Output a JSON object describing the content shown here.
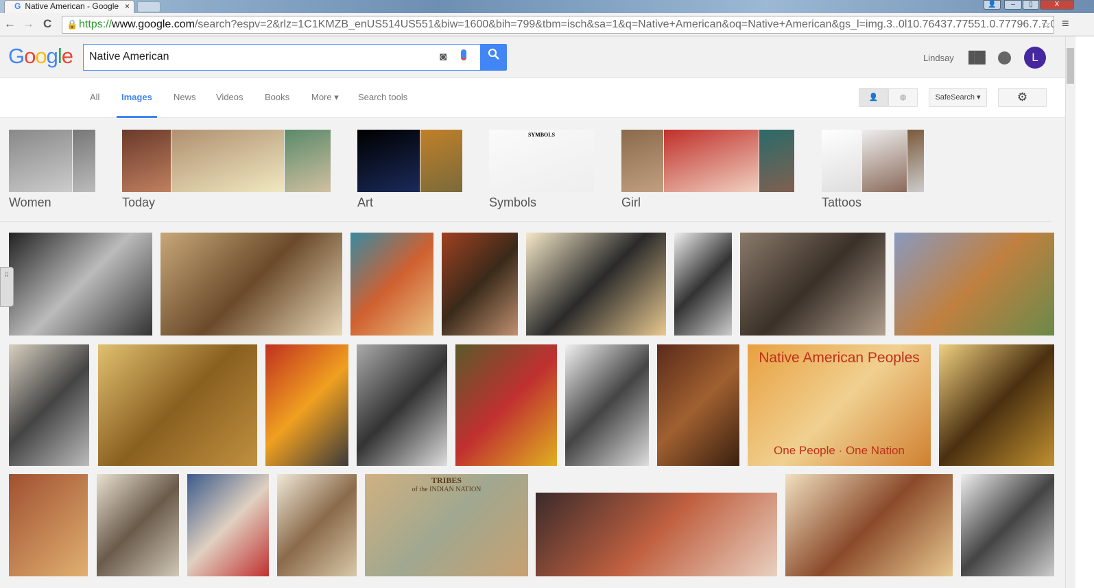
{
  "browser": {
    "tab_title": "Native American - Google",
    "tab_close": "×",
    "url_scheme": "https://",
    "url_host": "www.google.com",
    "url_rest": "/search?espv=2&rlz=1C1KMZB_enUS514US551&biw=1600&bih=799&tbm=isch&sa=1&q=Native+American&oq=Native+American&gs_l=img.3..0l10.76437.77551.0.77796.7.7.0",
    "back": "←",
    "forward": "→",
    "reload": "C",
    "star": "☆",
    "menu": "≡",
    "minimize": "–",
    "maximize": "▯",
    "close": "X",
    "user_btn": "👤"
  },
  "header": {
    "logo": [
      "G",
      "o",
      "o",
      "g",
      "l",
      "e"
    ],
    "logo_colors": [
      "#4285f4",
      "#ea4335",
      "#fbbc05",
      "#4285f4",
      "#34a853",
      "#ea4335"
    ],
    "query": "Native American",
    "user_name": "Lindsay",
    "avatar_letter": "L",
    "search_icon": "⚲",
    "camera": "📷",
    "mic": "🎤"
  },
  "nav": {
    "tabs": [
      {
        "label": "All"
      },
      {
        "label": "Images",
        "active": true
      },
      {
        "label": "News"
      },
      {
        "label": "Videos"
      },
      {
        "label": "Books"
      },
      {
        "label": "More ▾"
      },
      {
        "label": "Search tools"
      }
    ],
    "safesearch": "SafeSearch ▾",
    "settings": "⚙",
    "person": "👤",
    "globe": "◍"
  },
  "chips": [
    {
      "label": "Women"
    },
    {
      "label": "Today"
    },
    {
      "label": "Art"
    },
    {
      "label": "Symbols",
      "image_text": "SYMBOLS"
    },
    {
      "label": "Girl"
    },
    {
      "label": "Tattoos"
    }
  ],
  "image_texts": {
    "map_title": "Native American Peoples",
    "map_footer": "One People · One Nation",
    "tribes_title": "TRIBES",
    "tribes_sub": "of the INDIAN NATION"
  },
  "side_handle": "⁞⁞"
}
